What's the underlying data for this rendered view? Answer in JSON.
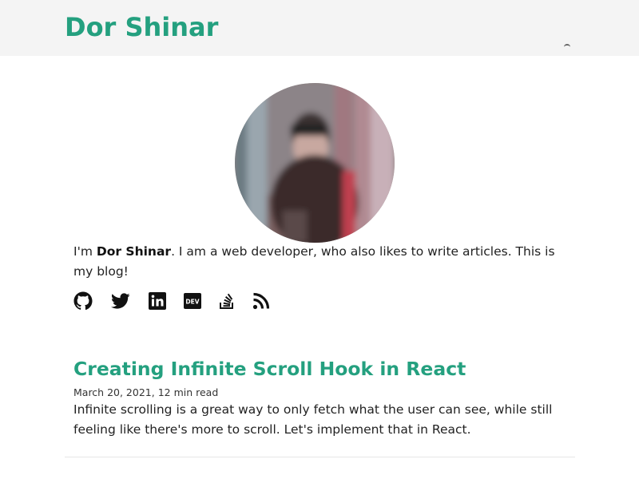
{
  "header": {
    "site_title": "Dor Shinar"
  },
  "bio": {
    "prefix": "I'm ",
    "name": "Dor Shinar",
    "suffix": ". I am a web developer, who also likes to write articles. This is my blog!"
  },
  "social_links": [
    {
      "name": "github",
      "icon": "github-icon"
    },
    {
      "name": "twitter",
      "icon": "twitter-icon"
    },
    {
      "name": "linkedin",
      "icon": "linkedin-icon"
    },
    {
      "name": "dev",
      "icon": "dev-icon",
      "text": "DEV"
    },
    {
      "name": "stackoverflow",
      "icon": "stackoverflow-icon"
    },
    {
      "name": "rss",
      "icon": "rss-icon"
    }
  ],
  "posts": [
    {
      "title": "Creating Infinite Scroll Hook in React",
      "meta": "March 20, 2021, 12 min read",
      "excerpt": "Infinite scrolling is a great way to only fetch what the user can see, while still feeling like there's more to scroll. Let's implement that in React."
    }
  ],
  "colors": {
    "accent": "#24a07f",
    "header_bg": "#f4f4f4",
    "text": "#222222"
  }
}
